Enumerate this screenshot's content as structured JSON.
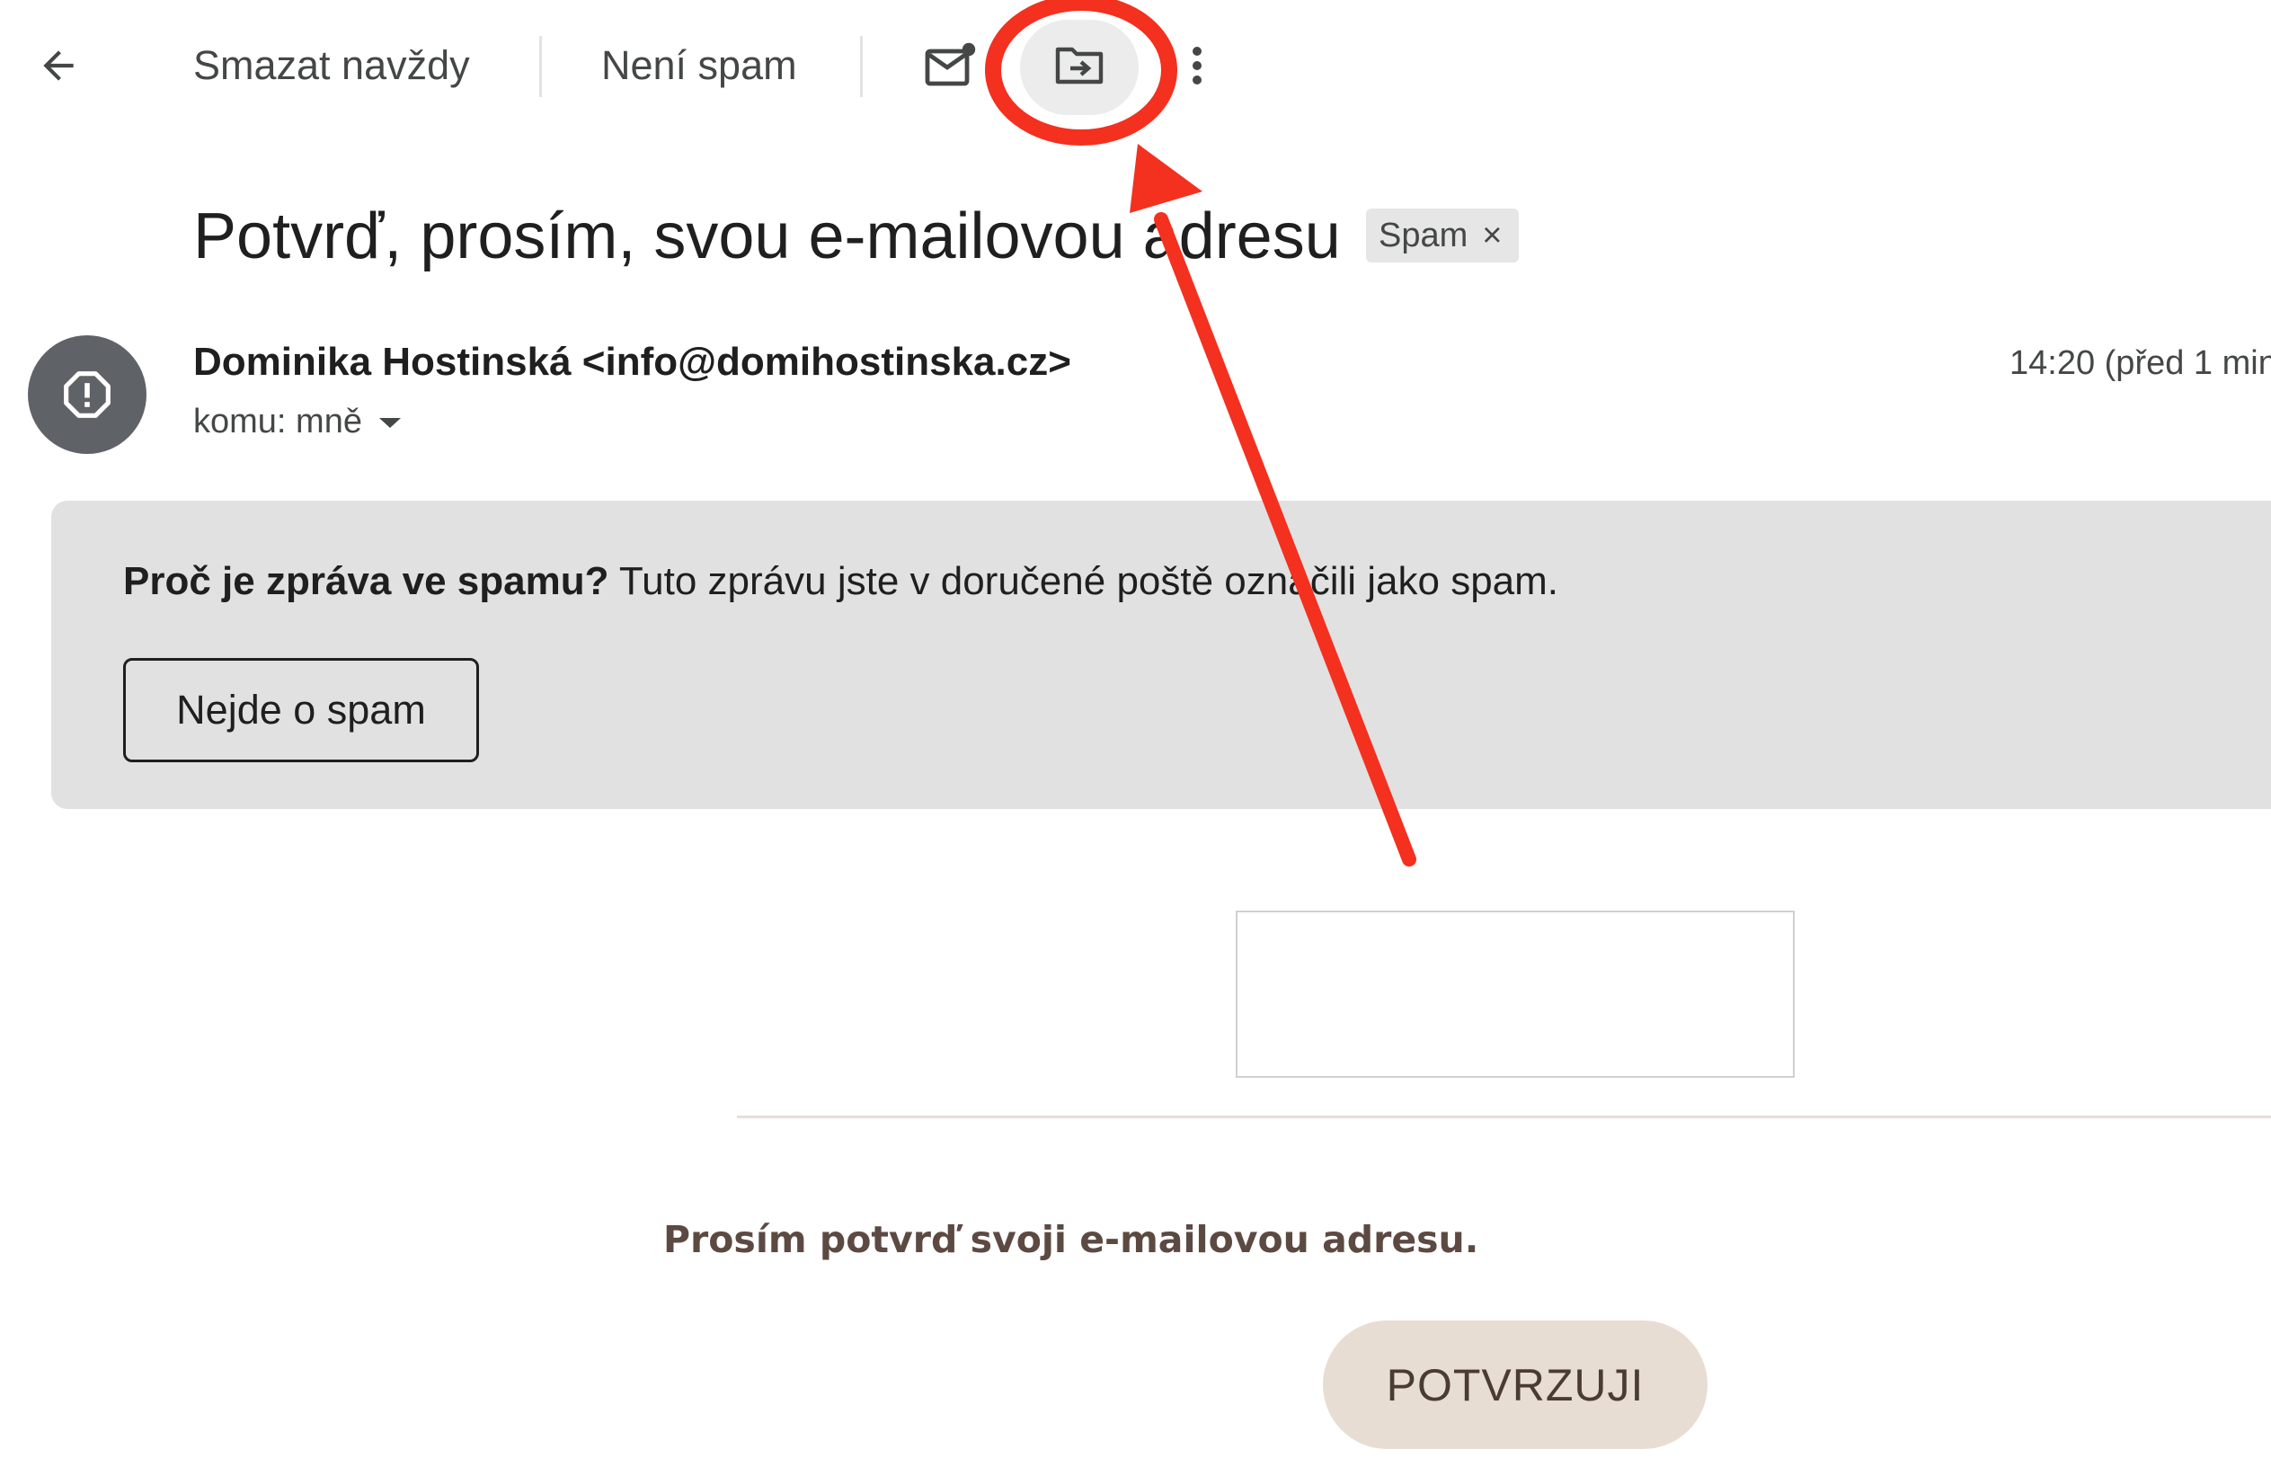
{
  "toolbar": {
    "back_icon": "arrow-left-icon",
    "delete_forever_label": "Smazat navždy",
    "not_spam_label": "Není spam",
    "mark_unread_icon": "mail-unread-icon",
    "move_to_icon": "folder-move-icon",
    "more_icon": "more-vert-icon"
  },
  "message": {
    "subject": "Potvrď, prosím, svou e-mailovou adresu",
    "label_chip": "Spam",
    "label_remove": "×",
    "sender": "Dominika Hostinská <info@domihostinska.cz>",
    "recipient": "komu: mně",
    "timestamp": "14:20 (před 1 min"
  },
  "spam_banner": {
    "question": "Proč je zpráva ve spamu?",
    "explanation": " Tuto zprávu jste v doručené poště označili jako spam.",
    "button_label": "Nejde o spam"
  },
  "email_body": {
    "text": "Prosím potvrď svoji e-mailovou adresu.",
    "confirm_button": "POTVRZUJI"
  },
  "colors": {
    "annotation_red": "#f4301f",
    "banner_bg": "#e1e1e1",
    "confirm_button_bg": "#e8ddd2",
    "avatar_bg": "#5f6368"
  }
}
